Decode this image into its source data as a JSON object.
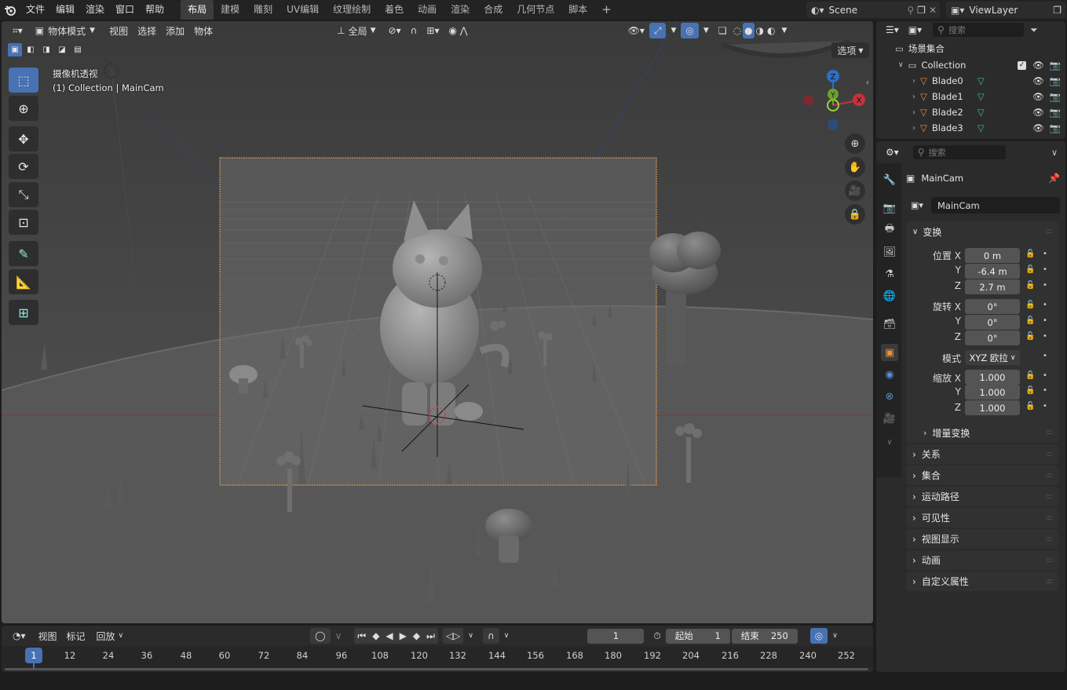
{
  "menus": [
    "文件",
    "编辑",
    "渲染",
    "窗口",
    "帮助"
  ],
  "workspaces": [
    "布局",
    "建模",
    "雕刻",
    "UV编辑",
    "纹理绘制",
    "着色",
    "动画",
    "渲染",
    "合成",
    "几何节点",
    "脚本"
  ],
  "scene_name": "Scene",
  "view_layer": "ViewLayer",
  "viewport": {
    "mode": "物体模式",
    "menus": [
      "视图",
      "选择",
      "添加",
      "物体"
    ],
    "transform_orientation": "全局",
    "options_label": "选项",
    "view_title": "摄像机透视",
    "view_subtitle": "(1) Collection | MainCam",
    "gizmo": {
      "z": "Z",
      "y": "Y",
      "x": "X"
    }
  },
  "outliner": {
    "search_placeholder": "搜索",
    "root": "场景集合",
    "collection": "Collection",
    "items": [
      "Blade0",
      "Blade1",
      "Blade2",
      "Blade3"
    ]
  },
  "properties": {
    "search_placeholder": "搜索",
    "object_name": "MainCam",
    "datablock_name": "MainCam",
    "transform_title": "变换",
    "location_label": "位置 X",
    "rotation_label": "旋转 X",
    "scale_label": "缩放 X",
    "y_label": "Y",
    "z_label": "Z",
    "location": [
      "0 m",
      "-6.4 m",
      "2.7 m"
    ],
    "rotation": [
      "0°",
      "0°",
      "0°"
    ],
    "mode_label": "模式",
    "mode_value": "XYZ 欧拉",
    "scale": [
      "1.000",
      "1.000",
      "1.000"
    ],
    "delta_transform": "增量变换",
    "panels": [
      "关系",
      "集合",
      "运动路径",
      "可见性",
      "视图显示",
      "动画",
      "自定义属性"
    ]
  },
  "timeline": {
    "menus": [
      "视图",
      "标记",
      "回放"
    ],
    "current_frame": "1",
    "start_label": "起始",
    "start_value": "1",
    "end_label": "结束",
    "end_value": "250",
    "playhead": "1",
    "ticks": [
      "12",
      "24",
      "36",
      "48",
      "60",
      "72",
      "84",
      "96",
      "108",
      "120",
      "132",
      "144",
      "156",
      "168",
      "180",
      "192",
      "204",
      "216",
      "228",
      "240",
      "252"
    ]
  },
  "colors": {
    "accent": "#4772b3",
    "camera_frame": "#e8a05a",
    "x_axis": "#c8303c",
    "y_axis": "#6aa030",
    "z_axis": "#2d6fc7",
    "object_orange": "#e8903a",
    "mesh_green": "#3ac08a"
  }
}
